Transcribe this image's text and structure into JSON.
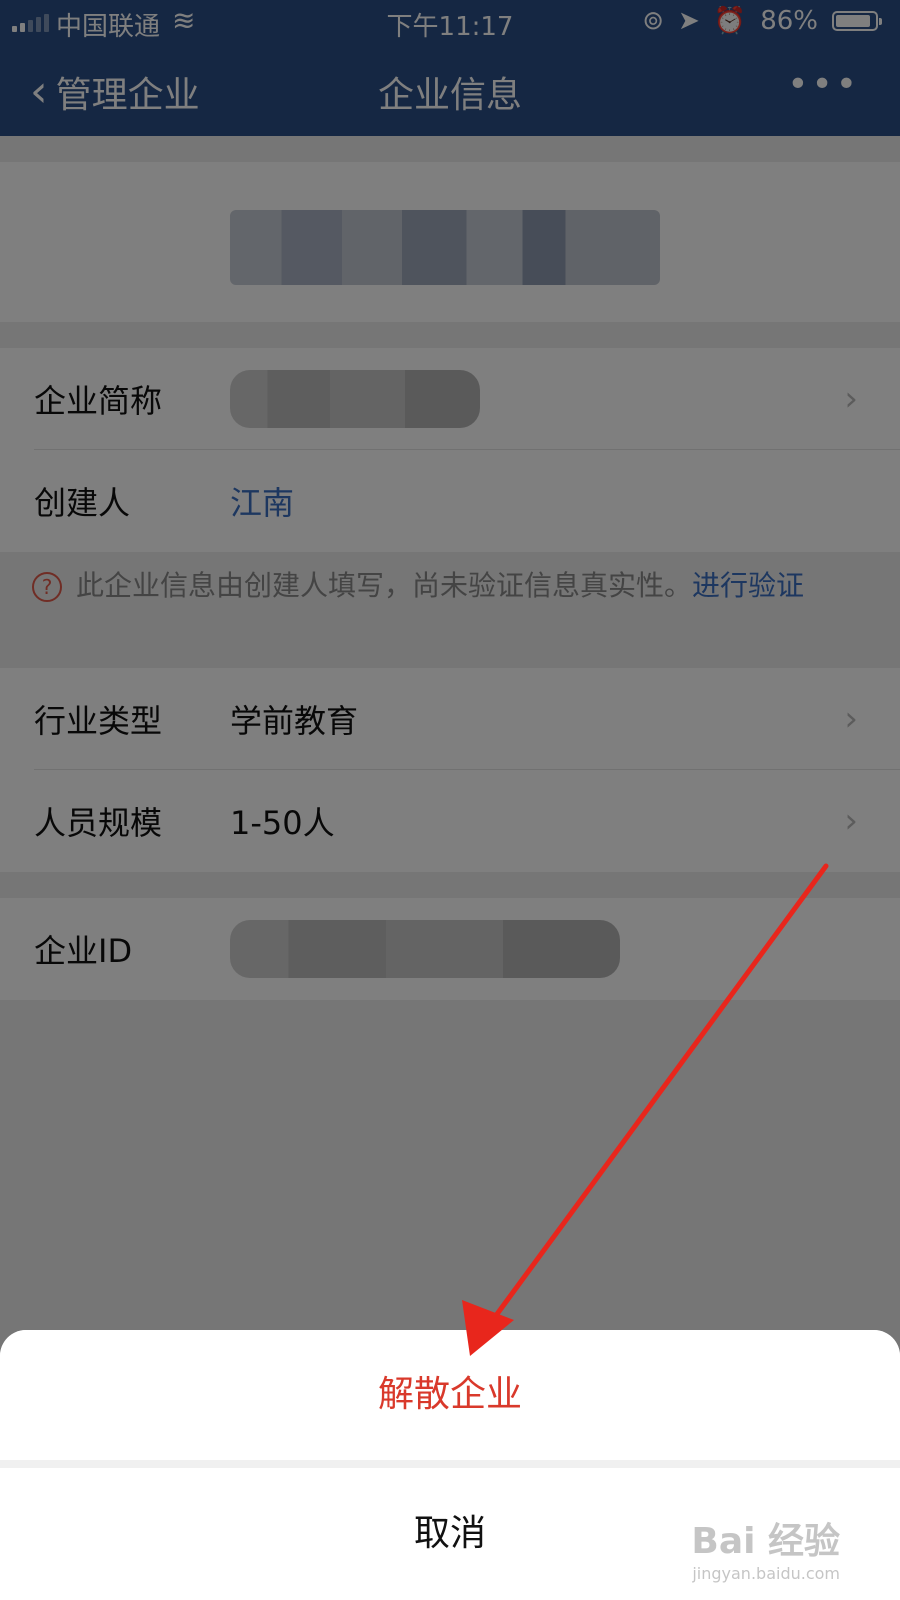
{
  "status_bar": {
    "carrier": "中国联通",
    "time": "下午11:17",
    "battery": "86%"
  },
  "nav": {
    "back_label": "管理企业",
    "title": "企业信息",
    "more": "•••"
  },
  "fields": {
    "short_name_label": "企业简称",
    "creator_label": "创建人",
    "creator_value": "江南",
    "industry_label": "行业类型",
    "industry_value": "学前教育",
    "size_label": "人员规模",
    "size_value": "1-50人",
    "id_label": "企业ID"
  },
  "notice": {
    "text": "此企业信息由创建人填写，尚未验证信息真实性。",
    "link": "进行验证"
  },
  "action_sheet": {
    "dissolve": "解散企业",
    "cancel": "取消"
  },
  "watermark": {
    "main": "Bai 经验",
    "sub": "jingyan.baidu.com"
  },
  "colors": {
    "nav_bg": "#2b4f86",
    "link": "#3a6fc0",
    "danger": "#d9392b",
    "annotation": "#e8261c"
  }
}
